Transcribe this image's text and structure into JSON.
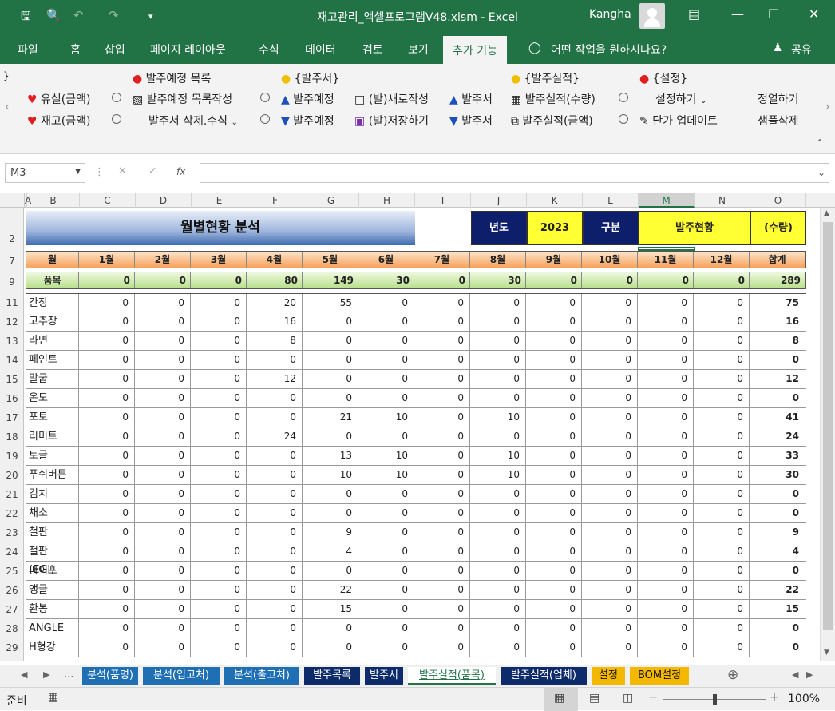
{
  "window": {
    "title": "재고관리_액셀프로그램V48.xlsm  -  Excel",
    "user": "Kangha"
  },
  "tabs": [
    "파일",
    "홈",
    "삽입",
    "페이지 레이아웃",
    "수식",
    "데이터",
    "검토",
    "보기",
    "추가 기능"
  ],
  "tell_me": "어떤 작업을 원하시나요?",
  "share": "공유",
  "ribbon": {
    "loss_amount": "유실(금액)",
    "stock_amount": "재고(금액)",
    "order_plan_list": "발주예정 목록",
    "order_plan_list_create": "발주예정 목록작성",
    "order_delete_formula": "발주서 삭제.수식",
    "order_group": "{발주서}",
    "order_plan_up": "발주예정",
    "order_plan_down": "발주예정",
    "order_new": "(발)새로작성",
    "order_save": "(발)저장하기",
    "order_up": "발주서",
    "order_down": "발주서",
    "result_group": "{발주실적}",
    "result_qty": "발주실적(수량)",
    "result_amount": "발주실적(금액)",
    "settings_group": "{설정}",
    "settings_do": "설정하기",
    "price_update": "단가 업데이트",
    "sort": "정열하기",
    "sample_delete": "샘플삭제"
  },
  "formula_bar": {
    "name_box": "M3",
    "fx": "fx"
  },
  "columns": [
    "A",
    "B",
    "C",
    "D",
    "E",
    "F",
    "G",
    "H",
    "I",
    "J",
    "K",
    "L",
    "M",
    "N",
    "O"
  ],
  "rows": [
    "2",
    "7",
    "9",
    "11",
    "12",
    "13",
    "14",
    "15",
    "16",
    "17",
    "18",
    "19",
    "20",
    "21",
    "22",
    "23",
    "24",
    "25",
    "26",
    "27",
    "28",
    "29"
  ],
  "sheet": {
    "title": "월별현황 분석",
    "year_label": "년도",
    "year_value": "2023",
    "type_label": "구분",
    "type_value": "발주현황",
    "unit": "(수량)",
    "month_header": [
      "월",
      "1월",
      "2월",
      "3월",
      "4월",
      "5월",
      "6월",
      "7월",
      "8월",
      "9월",
      "10월",
      "11월",
      "12월",
      "합계"
    ],
    "totals": [
      "품목",
      "0",
      "0",
      "0",
      "80",
      "149",
      "30",
      "0",
      "30",
      "0",
      "0",
      "0",
      "0",
      "289"
    ],
    "items": [
      [
        "간장",
        "0",
        "0",
        "0",
        "20",
        "55",
        "0",
        "0",
        "0",
        "0",
        "0",
        "0",
        "0",
        "75"
      ],
      [
        "고추장",
        "0",
        "0",
        "0",
        "16",
        "0",
        "0",
        "0",
        "0",
        "0",
        "0",
        "0",
        "0",
        "16"
      ],
      [
        "라면",
        "0",
        "0",
        "0",
        "8",
        "0",
        "0",
        "0",
        "0",
        "0",
        "0",
        "0",
        "0",
        "8"
      ],
      [
        "페인트",
        "0",
        "0",
        "0",
        "0",
        "0",
        "0",
        "0",
        "0",
        "0",
        "0",
        "0",
        "0",
        "0"
      ],
      [
        "말굽",
        "0",
        "0",
        "0",
        "12",
        "0",
        "0",
        "0",
        "0",
        "0",
        "0",
        "0",
        "0",
        "12"
      ],
      [
        "온도",
        "0",
        "0",
        "0",
        "0",
        "0",
        "0",
        "0",
        "0",
        "0",
        "0",
        "0",
        "0",
        "0"
      ],
      [
        "포토",
        "0",
        "0",
        "0",
        "0",
        "21",
        "10",
        "0",
        "10",
        "0",
        "0",
        "0",
        "0",
        "41"
      ],
      [
        "리미트",
        "0",
        "0",
        "0",
        "24",
        "0",
        "0",
        "0",
        "0",
        "0",
        "0",
        "0",
        "0",
        "24"
      ],
      [
        "토글",
        "0",
        "0",
        "0",
        "0",
        "13",
        "10",
        "0",
        "10",
        "0",
        "0",
        "0",
        "0",
        "33"
      ],
      [
        "푸쉬버튼",
        "0",
        "0",
        "0",
        "0",
        "10",
        "10",
        "0",
        "10",
        "0",
        "0",
        "0",
        "0",
        "30"
      ],
      [
        "김치",
        "0",
        "0",
        "0",
        "0",
        "0",
        "0",
        "0",
        "0",
        "0",
        "0",
        "0",
        "0",
        "0"
      ],
      [
        "채소",
        "0",
        "0",
        "0",
        "0",
        "0",
        "0",
        "0",
        "0",
        "0",
        "0",
        "0",
        "0",
        "0"
      ],
      [
        "철판",
        "0",
        "0",
        "0",
        "0",
        "9",
        "0",
        "0",
        "0",
        "0",
        "0",
        "0",
        "0",
        "9"
      ],
      [
        "철판(EGI)",
        "0",
        "0",
        "0",
        "0",
        "4",
        "0",
        "0",
        "0",
        "0",
        "0",
        "0",
        "0",
        "4"
      ],
      [
        "파이프",
        "0",
        "0",
        "0",
        "0",
        "0",
        "0",
        "0",
        "0",
        "0",
        "0",
        "0",
        "0",
        "0"
      ],
      [
        "앵글",
        "0",
        "0",
        "0",
        "0",
        "22",
        "0",
        "0",
        "0",
        "0",
        "0",
        "0",
        "0",
        "22"
      ],
      [
        "환봉",
        "0",
        "0",
        "0",
        "0",
        "15",
        "0",
        "0",
        "0",
        "0",
        "0",
        "0",
        "0",
        "15"
      ],
      [
        "ANGLE",
        "0",
        "0",
        "0",
        "0",
        "0",
        "0",
        "0",
        "0",
        "0",
        "0",
        "0",
        "0",
        "0"
      ],
      [
        "H형강",
        "0",
        "0",
        "0",
        "0",
        "0",
        "0",
        "0",
        "0",
        "0",
        "0",
        "0",
        "0",
        "0"
      ]
    ]
  },
  "sheet_tabs": [
    {
      "label": "분석(품명)",
      "color": "#1f6fb5"
    },
    {
      "label": "분석(입고처)",
      "color": "#1f6fb5"
    },
    {
      "label": "분석(출고처)",
      "color": "#1f6fb5"
    },
    {
      "label": "발주목록",
      "color": "#0d2a6b"
    },
    {
      "label": "발주서",
      "color": "#0d2a6b"
    },
    {
      "label": "발주실적(품목)",
      "color": "#ffffff"
    },
    {
      "label": "발주실적(업체)",
      "color": "#0d2a6b"
    },
    {
      "label": "설정",
      "color": "#f5b800"
    },
    {
      "label": "BOM설정",
      "color": "#f5b800"
    }
  ],
  "tab_nav": "...",
  "status": {
    "ready": "준비",
    "zoom": "100%"
  },
  "colors": {
    "excel_green": "#217346"
  }
}
